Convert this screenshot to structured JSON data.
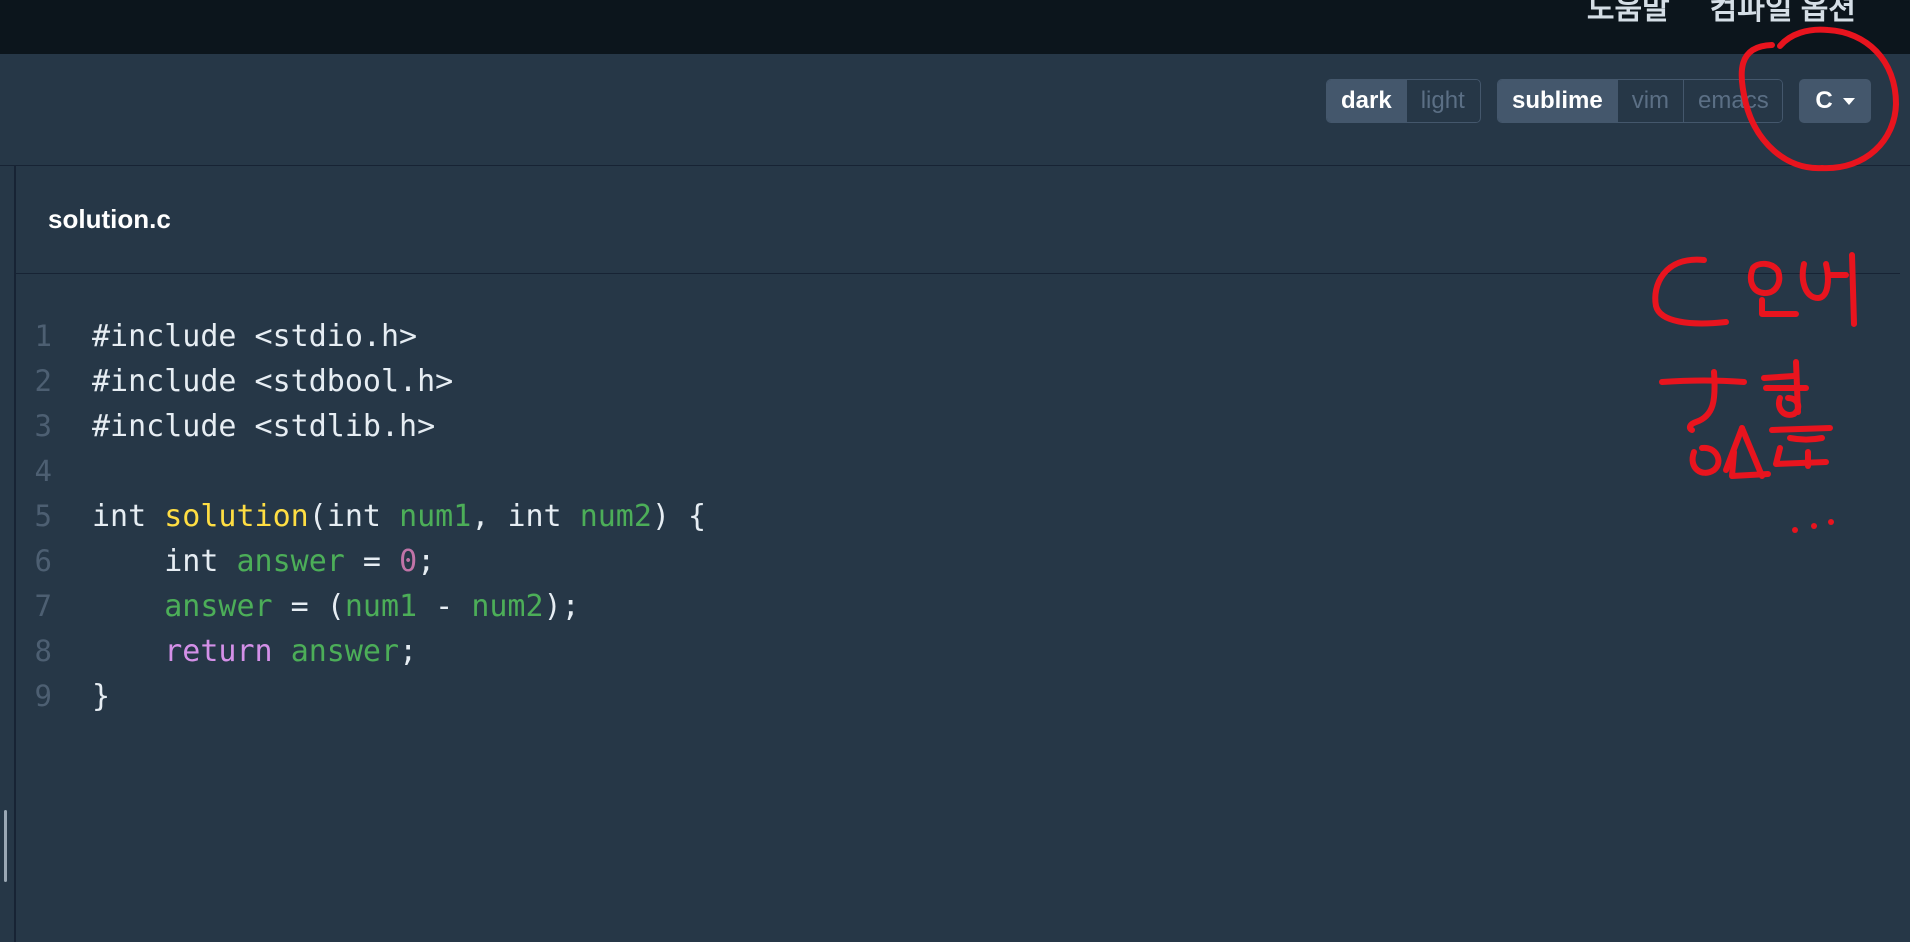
{
  "topbar": {
    "link_help": "도움말",
    "link_compile_options": "컴파일 옵션"
  },
  "toolbar": {
    "theme_dark": "dark",
    "theme_light": "light",
    "keymap_sublime": "sublime",
    "keymap_vim": "vim",
    "keymap_emacs": "emacs",
    "language": "C"
  },
  "editor": {
    "file_name": "solution.c",
    "line_numbers": [
      "1",
      "2",
      "3",
      "4",
      "5",
      "6",
      "7",
      "8",
      "9"
    ],
    "lines": {
      "l1": "#include <stdio.h>",
      "l2": "#include <stdbool.h>",
      "l3": "#include <stdlib.h>",
      "l5_type": "int ",
      "l5_fn": "solution",
      "l5_open": "(",
      "l5_t1": "int ",
      "l5_p1": "num1",
      "l5_sep": ", ",
      "l5_t2": "int ",
      "l5_p2": "num2",
      "l5_close": ") {",
      "l6_indent": "    int ",
      "l6_var": "answer",
      "l6_eq": " = ",
      "l6_num": "0",
      "l6_end": ";",
      "l7_indent": "    ",
      "l7_var": "answer",
      "l7_mid": " = (",
      "l7_a": "num1",
      "l7_op": " - ",
      "l7_b": "num2",
      "l7_end": ");",
      "l8_indent": "    ",
      "l8_kw": "return",
      "l8_sp": " ",
      "l8_var": "answer",
      "l8_end": ";",
      "l9": "}"
    }
  },
  "colors": {
    "background": "#263747",
    "topbar": "#0c151c",
    "keyword": "#d490e8",
    "function": "#ffde43",
    "variable": "#4cae58",
    "number": "#c174a8",
    "annotation": "#e8141e"
  }
}
